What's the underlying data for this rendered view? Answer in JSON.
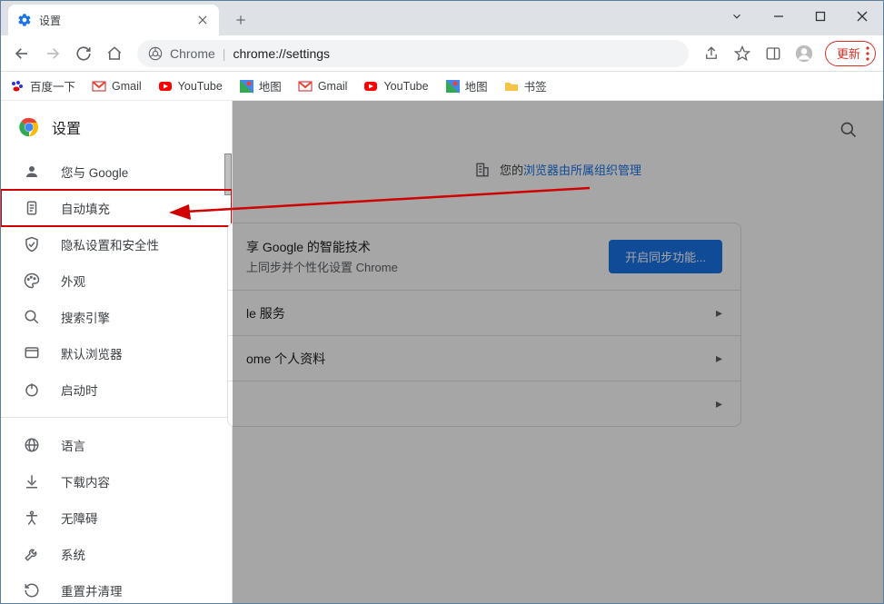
{
  "tab": {
    "title": "设置"
  },
  "omnibox": {
    "context": "Chrome",
    "url": "chrome://settings"
  },
  "update_button": "更新",
  "bookmarks": [
    {
      "label": "百度一下",
      "icon": "baidu"
    },
    {
      "label": "Gmail",
      "icon": "gmail"
    },
    {
      "label": "YouTube",
      "icon": "youtube"
    },
    {
      "label": "地图",
      "icon": "maps"
    },
    {
      "label": "Gmail",
      "icon": "gmail"
    },
    {
      "label": "YouTube",
      "icon": "youtube"
    },
    {
      "label": "地图",
      "icon": "maps"
    },
    {
      "label": "书签",
      "icon": "folder"
    }
  ],
  "sidebar": {
    "header": "设置",
    "items": [
      {
        "label": "您与 Google",
        "icon": "person"
      },
      {
        "label": "自动填充",
        "icon": "autofill",
        "highlight": true
      },
      {
        "label": "隐私设置和安全性",
        "icon": "privacy"
      },
      {
        "label": "外观",
        "icon": "appearance"
      },
      {
        "label": "搜索引擎",
        "icon": "search"
      },
      {
        "label": "默认浏览器",
        "icon": "defaultbrowser"
      },
      {
        "label": "启动时",
        "icon": "onstartup"
      }
    ],
    "items2": [
      {
        "label": "语言",
        "icon": "language"
      },
      {
        "label": "下载内容",
        "icon": "downloads"
      },
      {
        "label": "无障碍",
        "icon": "accessibility"
      },
      {
        "label": "系统",
        "icon": "system"
      },
      {
        "label": "重置并清理",
        "icon": "reset"
      }
    ]
  },
  "main": {
    "managed_prefix": "您的",
    "managed_link": "浏览器由所属组织管理",
    "sync_title": "享 Google 的智能技术",
    "sync_sub": "上同步并个性化设置 Chrome",
    "sync_button": "开启同步功能...",
    "rows": [
      "le 服务",
      "ome 个人资料",
      ""
    ]
  }
}
